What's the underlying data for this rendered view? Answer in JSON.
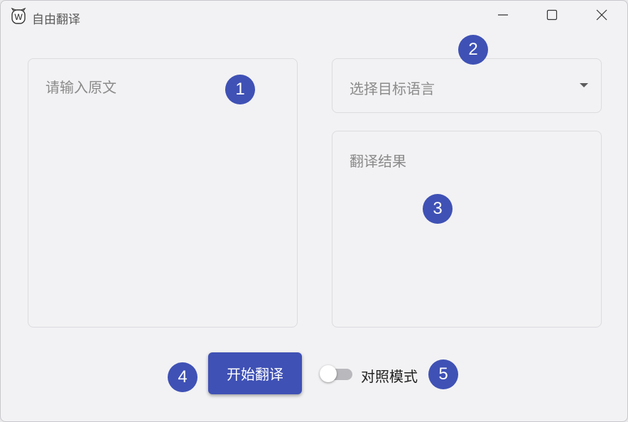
{
  "window": {
    "title": "自由翻译",
    "app_icon": "w-logo-icon",
    "controls": [
      "minimize-icon",
      "maximize-icon",
      "close-icon"
    ]
  },
  "source": {
    "placeholder": "请输入原文",
    "value": ""
  },
  "target_language": {
    "placeholder": "选择目标语言",
    "arrow_icon": "dropdown-arrow-icon"
  },
  "result": {
    "placeholder": "翻译结果"
  },
  "actions": {
    "translate_label": "开始翻译",
    "compare_mode_label": "对照模式",
    "compare_mode_on": false
  },
  "annotations": [
    "1",
    "2",
    "3",
    "4",
    "5"
  ],
  "colors": {
    "accent": "#3f51b5",
    "window_bg": "#f2f2f4",
    "border": "#dcdce0"
  }
}
